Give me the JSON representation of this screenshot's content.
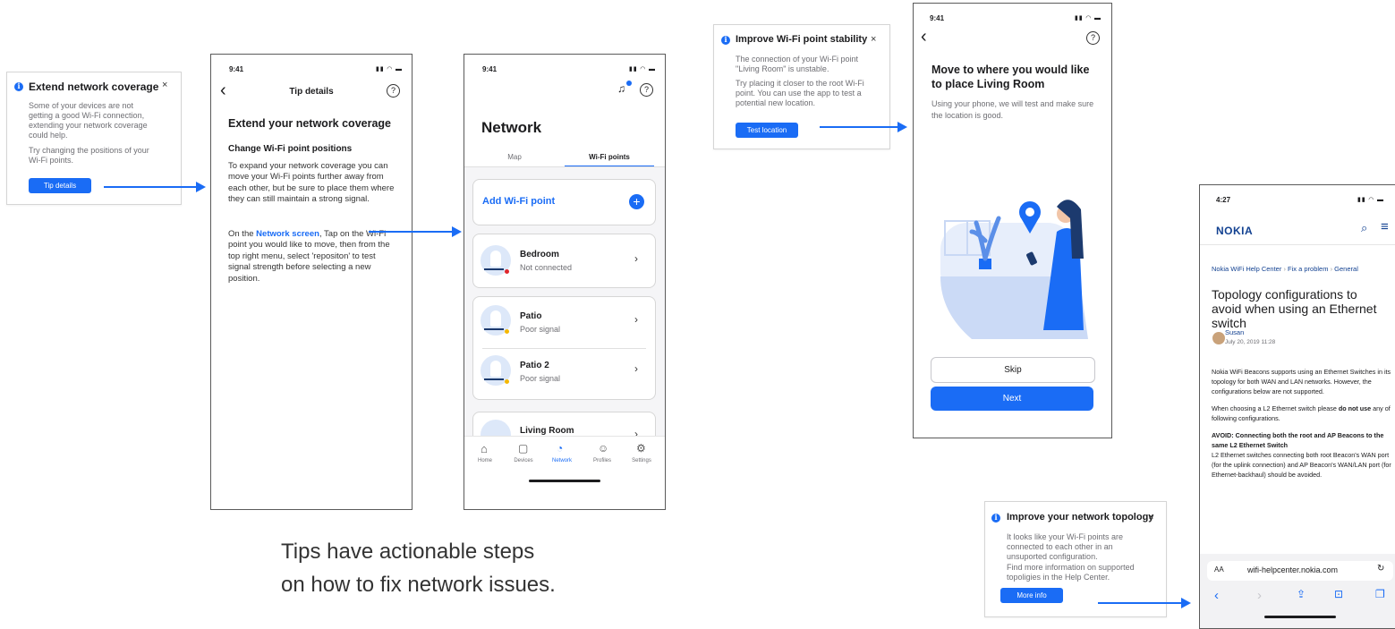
{
  "caption": {
    "line1": "Tips have actionable steps",
    "line2": "on how to fix network issues."
  },
  "colors": {
    "accent": "#1a6cf5",
    "red_dot": "#e0262c",
    "yellow_dot": "#f5b800"
  },
  "tip_extend": {
    "title": "Extend network coverage",
    "close": "×",
    "body1": "Some of your devices are not getting a good Wi-Fi connection, extending your network coverage could help.",
    "body2": "Try changing the positions of your Wi-Fi points.",
    "button": "Tip details"
  },
  "tip_details_screen": {
    "time": "9:41",
    "nav_title": "Tip details",
    "back": "‹",
    "help": "?",
    "heading": "Extend your network coverage",
    "subheading": "Change Wi-Fi point positions",
    "para1": "To expand your network coverage you can move your Wi-Fi points further away from each other, but be sure to place them where they can still maintain a strong signal.",
    "para2_prefix": "On the ",
    "para2_link": "Network screen",
    "para2_suffix": ", Tap on the Wi-Fi point you would like to move, then from the top right menu, select 'repositon' to test signal strength before selecting a new position."
  },
  "network_screen": {
    "time": "9:41",
    "title": "Network",
    "tabs": [
      "Map",
      "Wi-Fi points"
    ],
    "add_label": "Add Wi-Fi point",
    "add_symbol": "+",
    "points": [
      {
        "name": "Bedroom",
        "status": "Not connected"
      },
      {
        "name": "Patio",
        "status": "Poor signal"
      },
      {
        "name": "Patio 2",
        "status": "Poor signal"
      },
      {
        "name": "Living Room",
        "status": ""
      }
    ],
    "tabbar": [
      "Home",
      "Devices",
      "Network",
      "Profiles",
      "Settings"
    ]
  },
  "tip_stability": {
    "title": "Improve Wi-Fi point stability",
    "close": "×",
    "body1": "The connection of your Wi-Fi point \"Living Room\" is unstable.",
    "body2": "Try placing it closer to the root Wi-Fi point. You can use the app to test a potential new location.",
    "button": "Test location"
  },
  "placement_screen": {
    "time": "9:41",
    "back": "‹",
    "help": "?",
    "heading": "Move to where you would like to place Living Room",
    "body": "Using your phone, we will test and make sure the location is good.",
    "skip": "Skip",
    "next": "Next"
  },
  "tip_topology": {
    "title": "Improve your network topology",
    "close": "×",
    "body1": "It looks like your Wi-Fi points are connected to each other in an unsuported configuration.",
    "body2": "Find more information on supported topoligies in the Help Center.",
    "button": "More info"
  },
  "browser_screen": {
    "time": "4:27",
    "brand": "NOKIA",
    "breadcrumb": [
      "Nokia WiFi Help Center",
      "Fix a problem",
      "General"
    ],
    "breadcrumb_sep": "›",
    "title": "Topology configurations to avoid when using an Ethernet switch",
    "author": "Susan",
    "date": "July 20, 2019 11:28",
    "p1": "Nokia WiFi Beacons supports using an Ethernet Switches in its topology for both WAN and LAN networks. However, the configurations below are not supported.",
    "p2_prefix": "When choosing a L2 Ethernet switch please ",
    "p2_bold": "do not use",
    "p2_suffix": " any of following configurations.",
    "p3_heading": "AVOID: Connecting both the root and AP Beacons to the same L2 Ethernet Switch",
    "p3_body": "L2 Ethernet switches connecting both root Beacon's WAN port (for the uplink connection) and AP Beacon's WAN/LAN port (for Ethernet-backhaul) should be avoided.",
    "url_aa": "AA",
    "url": "wifi-helpcenter.nokia.com"
  }
}
